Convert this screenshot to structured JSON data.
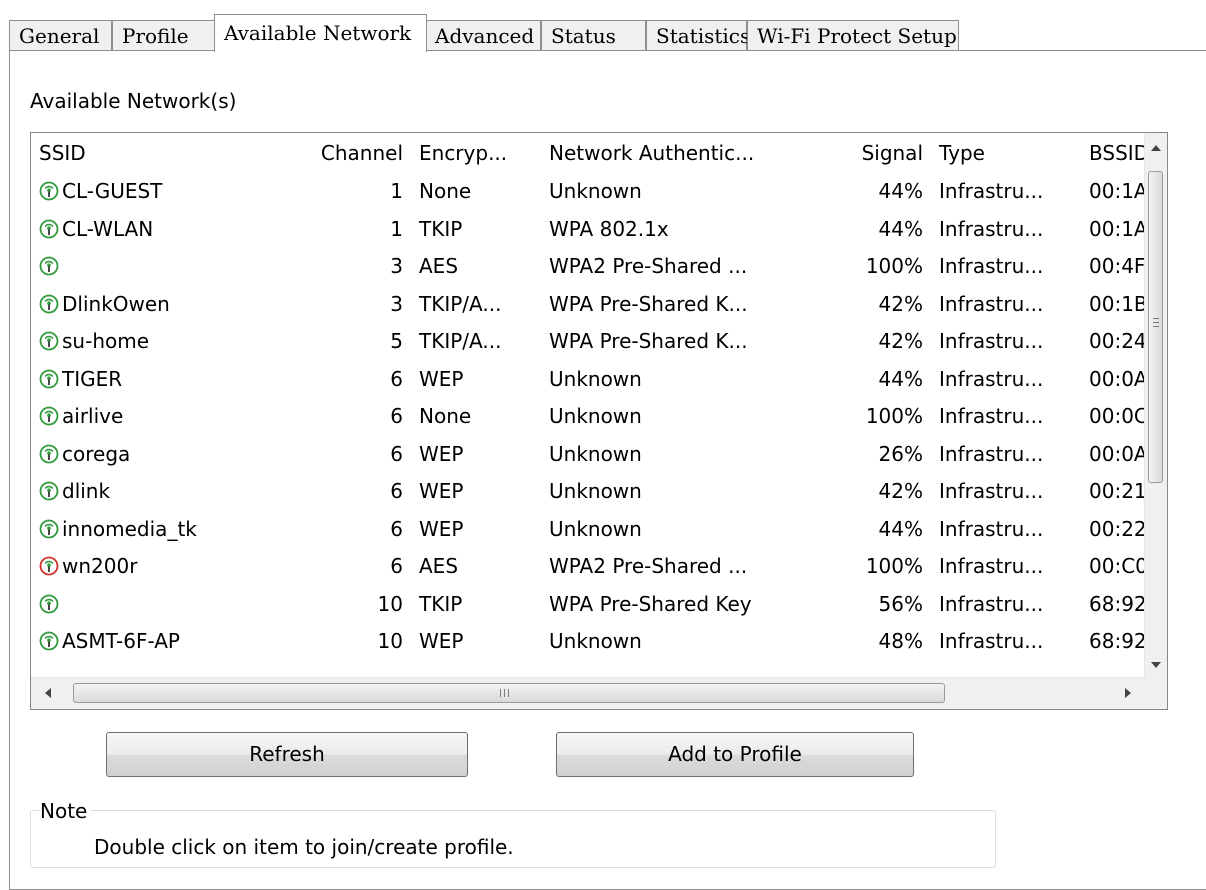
{
  "tabs": [
    {
      "label": "General"
    },
    {
      "label": "Profile"
    },
    {
      "label": "Available Network"
    },
    {
      "label": "Advanced"
    },
    {
      "label": "Status"
    },
    {
      "label": "Statistics"
    },
    {
      "label": "Wi-Fi Protect Setup"
    }
  ],
  "active_tab": "Available Network",
  "section_title": "Available Network(s)",
  "table": {
    "columns": [
      "SSID",
      "Channel",
      "Encryp...",
      "Network Authentic...",
      "Signal",
      "Type",
      "BSSID"
    ],
    "rows": [
      {
        "ssid": "CL-GUEST",
        "channel": "1",
        "encryption": "None",
        "auth": "Unknown",
        "signal": "44%",
        "type": "Infrastru...",
        "bssid": "00:1A"
      },
      {
        "ssid": "CL-WLAN",
        "channel": "1",
        "encryption": "TKIP",
        "auth": "WPA 802.1x",
        "signal": "44%",
        "type": "Infrastru...",
        "bssid": "00:1A"
      },
      {
        "ssid": "",
        "channel": "3",
        "encryption": "AES",
        "auth": "WPA2 Pre-Shared ...",
        "signal": "100%",
        "type": "Infrastru...",
        "bssid": "00:4F"
      },
      {
        "ssid": "DlinkOwen",
        "channel": "3",
        "encryption": "TKIP/A...",
        "auth": "WPA Pre-Shared K...",
        "signal": "42%",
        "type": "Infrastru...",
        "bssid": "00:1B"
      },
      {
        "ssid": "su-home",
        "channel": "5",
        "encryption": "TKIP/A...",
        "auth": "WPA Pre-Shared K...",
        "signal": "42%",
        "type": "Infrastru...",
        "bssid": "00:24"
      },
      {
        "ssid": "TIGER",
        "channel": "6",
        "encryption": "WEP",
        "auth": "Unknown",
        "signal": "44%",
        "type": "Infrastru...",
        "bssid": "00:0A"
      },
      {
        "ssid": "airlive",
        "channel": "6",
        "encryption": "None",
        "auth": "Unknown",
        "signal": "100%",
        "type": "Infrastru...",
        "bssid": "00:0C"
      },
      {
        "ssid": "corega",
        "channel": "6",
        "encryption": "WEP",
        "auth": "Unknown",
        "signal": "26%",
        "type": "Infrastru...",
        "bssid": "00:0A"
      },
      {
        "ssid": "dlink",
        "channel": "6",
        "encryption": "WEP",
        "auth": "Unknown",
        "signal": "42%",
        "type": "Infrastru...",
        "bssid": "00:21"
      },
      {
        "ssid": "innomedia_tk",
        "channel": "6",
        "encryption": "WEP",
        "auth": "Unknown",
        "signal": "44%",
        "type": "Infrastru...",
        "bssid": "00:22"
      },
      {
        "ssid": "wn200r",
        "channel": "6",
        "encryption": "AES",
        "auth": "WPA2 Pre-Shared ...",
        "signal": "100%",
        "type": "Infrastru...",
        "bssid": "00:C0",
        "icon_variant": "connected"
      },
      {
        "ssid": "",
        "channel": "10",
        "encryption": "TKIP",
        "auth": "WPA Pre-Shared Key",
        "signal": "56%",
        "type": "Infrastru...",
        "bssid": "68:92"
      },
      {
        "ssid": "ASMT-6F-AP",
        "channel": "10",
        "encryption": "WEP",
        "auth": "Unknown",
        "signal": "48%",
        "type": "Infrastru...",
        "bssid": "68:92"
      }
    ]
  },
  "icons": {
    "network": "wifi-antenna-icon",
    "network_connected": "wifi-antenna-connected-icon",
    "scroll_up": "scroll-up-arrow-icon",
    "scroll_down": "scroll-down-arrow-icon",
    "scroll_left": "scroll-left-arrow-icon",
    "scroll_right": "scroll-right-arrow-icon"
  },
  "colors": {
    "antenna_green": "#2e9a3a",
    "antenna_red": "#d0302a",
    "border": "#828790"
  },
  "buttons": {
    "refresh": "Refresh",
    "add_to_profile": "Add to Profile"
  },
  "note": {
    "label": "Note",
    "text": "Double click on item to join/create profile."
  }
}
